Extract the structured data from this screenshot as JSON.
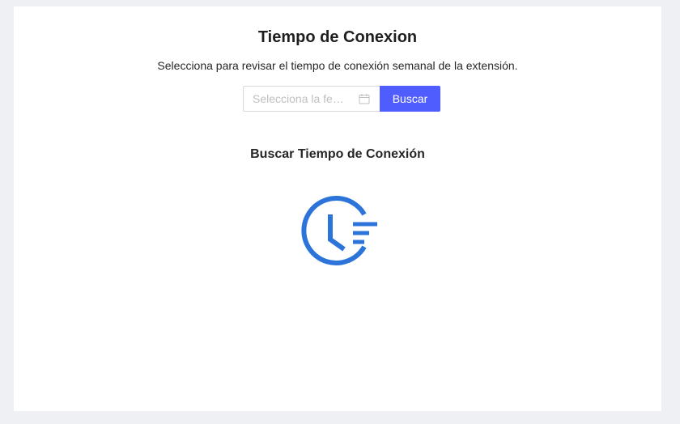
{
  "page": {
    "title": "Tiempo de Conexion",
    "subtitle": "Selecciona para revisar el tiempo de conexión semanal de la extensión."
  },
  "date_picker": {
    "placeholder": "Selecciona la fe…",
    "icon": "calendar-icon"
  },
  "search_button": {
    "label": "Buscar"
  },
  "result": {
    "title": "Buscar Tiempo de Conexión",
    "icon": "clock-history-icon"
  },
  "colors": {
    "accent": "#4f5dff",
    "icon_blue": "#2d74da",
    "background": "#eef0f4"
  }
}
